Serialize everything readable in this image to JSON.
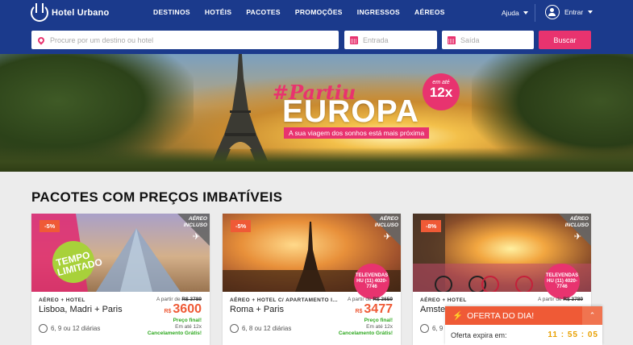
{
  "brand": {
    "name": "Hotel Urbano"
  },
  "nav": [
    "DESTINOS",
    "HOTÉIS",
    "PACOTES",
    "PROMOÇÕES",
    "INGRESSOS",
    "AÉREOS"
  ],
  "header": {
    "help": "Ajuda",
    "login": "Entrar"
  },
  "search": {
    "destination_placeholder": "Procure por um destino ou hotel",
    "checkin_placeholder": "Entrada",
    "checkout_placeholder": "Saída",
    "button": "Buscar"
  },
  "hero": {
    "tag": "#Partiu",
    "title": "EUROPA",
    "subtitle": "A sua viagem dos sonhos está mais próxima",
    "badge_small": "em até",
    "badge_big": "12x"
  },
  "section": {
    "title": "PACOTES COM PREÇOS IMBATÍVEIS"
  },
  "cards": [
    {
      "discount": "-5%",
      "corner": "AÉREO\nINCLUSO",
      "overlay": "TEMPO LIMITADO",
      "type": "AÉREO + HOTEL",
      "destination": "Lisboa, Madri + Paris",
      "from_label": "A partir de",
      "old_price": "R$ 3789",
      "currency": "R$",
      "price": "3600",
      "notes1": "Preço final!",
      "notes2": "Em até 12x",
      "notes3": "Cancelamento Grátis!",
      "days": "6, 9 ou 12 diárias"
    },
    {
      "discount": "-5%",
      "corner": "AÉREO\nINCLUSO",
      "overlay": "TELEVENDAS HU (11) 4020-7746",
      "type": "AÉREO + HOTEL C/ APARTAMENTO I...",
      "destination": "Roma + Paris",
      "from_label": "A partir de",
      "old_price": "R$ 3659",
      "currency": "R$",
      "price": "3477",
      "notes1": "Preço final!",
      "notes2": "Em até 12x",
      "notes3": "Cancelamento Grátis!",
      "days": "6, 8 ou 12 diárias"
    },
    {
      "discount": "-8%",
      "corner": "AÉREO\nINCLUSO",
      "overlay": "TELEVENDAS HU (11) 4020-7746",
      "type": "AÉREO + HOTEL",
      "destination": "Amste",
      "from_label": "A partir de",
      "old_price": "R$ 3789",
      "currency": "",
      "price": "",
      "notes1": "",
      "notes2": "",
      "notes3": "",
      "days": "6, 9"
    }
  ],
  "offer": {
    "title": "OFERTA DO DIA!",
    "expires": "Oferta expira em:",
    "timer": "11 : 55 : 05"
  },
  "colors": {
    "primary": "#1b3a8c",
    "accent": "#e8336f",
    "orange": "#ef5a36",
    "green": "#2ea81f"
  }
}
